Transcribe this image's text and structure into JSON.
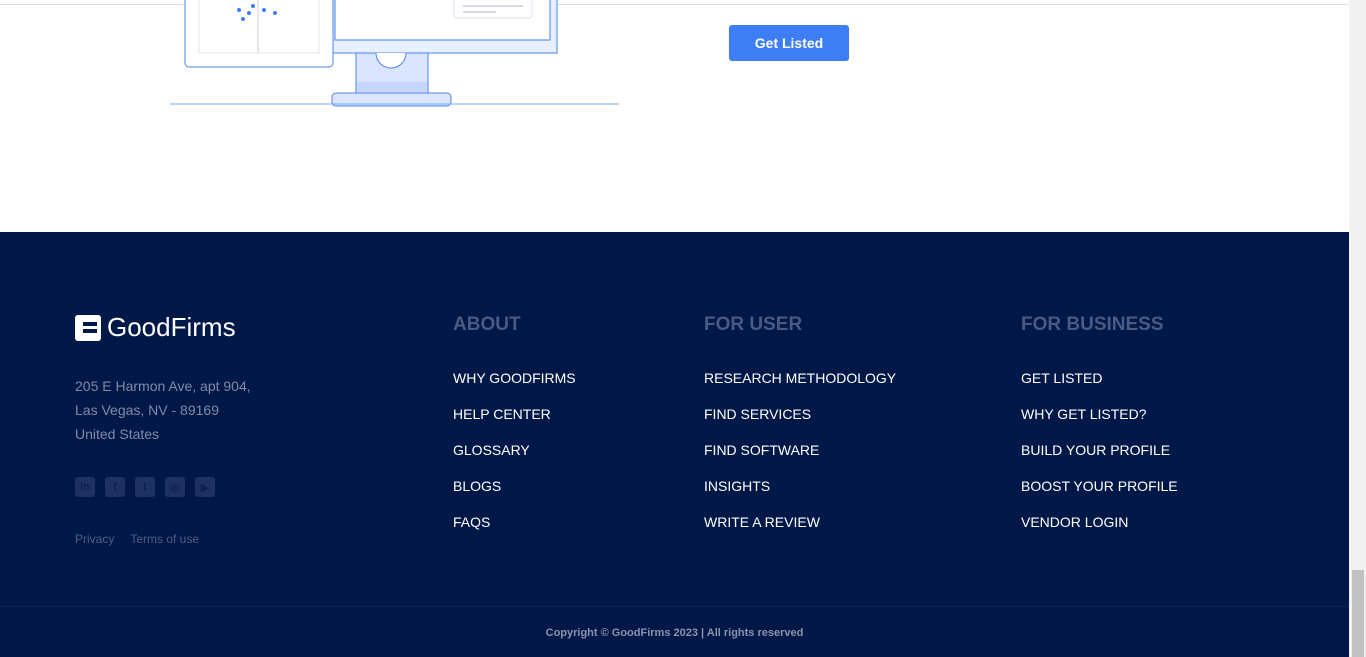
{
  "cta": {
    "get_listed": "Get Listed"
  },
  "footer": {
    "brand": "GoodFirms",
    "address": [
      "205 E Harmon Ave, apt 904,",
      "Las Vegas, NV - 89169",
      "United States"
    ],
    "social": [
      "linkedin-icon",
      "facebook-icon",
      "twitter-icon",
      "instagram-icon",
      "youtube-icon"
    ],
    "legal": {
      "privacy": "Privacy",
      "terms": "Terms of use"
    },
    "columns": [
      {
        "title": "ABOUT",
        "links": [
          "WHY GOODFIRMS",
          "HELP CENTER",
          "GLOSSARY",
          "BLOGS",
          "FAQS"
        ]
      },
      {
        "title": "FOR USER",
        "links": [
          "RESEARCH METHODOLOGY",
          "FIND SERVICES",
          "FIND SOFTWARE",
          "INSIGHTS",
          "WRITE A REVIEW"
        ]
      },
      {
        "title": "FOR BUSINESS",
        "links": [
          "GET LISTED",
          "WHY GET LISTED?",
          "BUILD YOUR PROFILE",
          "BOOST YOUR PROFILE",
          "VENDOR LOGIN"
        ]
      }
    ],
    "copyright": "Copyright © GoodFirms 2023 | All rights reserved"
  }
}
